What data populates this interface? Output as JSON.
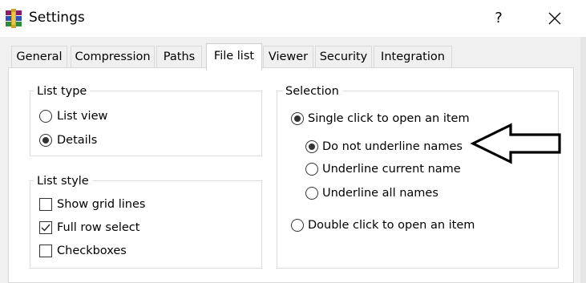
{
  "window": {
    "title": "Settings",
    "help_glyph": "?",
    "close_glyph": "×"
  },
  "tabs": [
    {
      "label": "General",
      "active": false
    },
    {
      "label": "Compression",
      "active": false
    },
    {
      "label": "Paths",
      "active": false
    },
    {
      "label": "File list",
      "active": true
    },
    {
      "label": "Viewer",
      "active": false
    },
    {
      "label": "Security",
      "active": false
    },
    {
      "label": "Integration",
      "active": false
    }
  ],
  "list_type": {
    "legend": "List type",
    "options": [
      {
        "label": "List view",
        "selected": false
      },
      {
        "label": "Details",
        "selected": true
      }
    ]
  },
  "list_style": {
    "legend": "List style",
    "options": [
      {
        "label": "Show grid lines",
        "checked": false
      },
      {
        "label": "Full row select",
        "checked": true
      },
      {
        "label": "Checkboxes",
        "checked": false
      }
    ]
  },
  "selection": {
    "legend": "Selection",
    "single_click": {
      "label": "Single click to open an item",
      "selected": true
    },
    "sub_options": [
      {
        "label": "Do not underline names",
        "selected": true
      },
      {
        "label": "Underline current name",
        "selected": false
      },
      {
        "label": "Underline all names",
        "selected": false
      }
    ],
    "double_click": {
      "label": "Double click to open an item",
      "selected": false
    }
  },
  "annotation": {
    "arrow_direction": "left"
  },
  "colors": {
    "dialog_bg": "#f0f0f0",
    "panel_bg": "#ffffff",
    "border": "#d9d9d9",
    "text": "#000000"
  }
}
